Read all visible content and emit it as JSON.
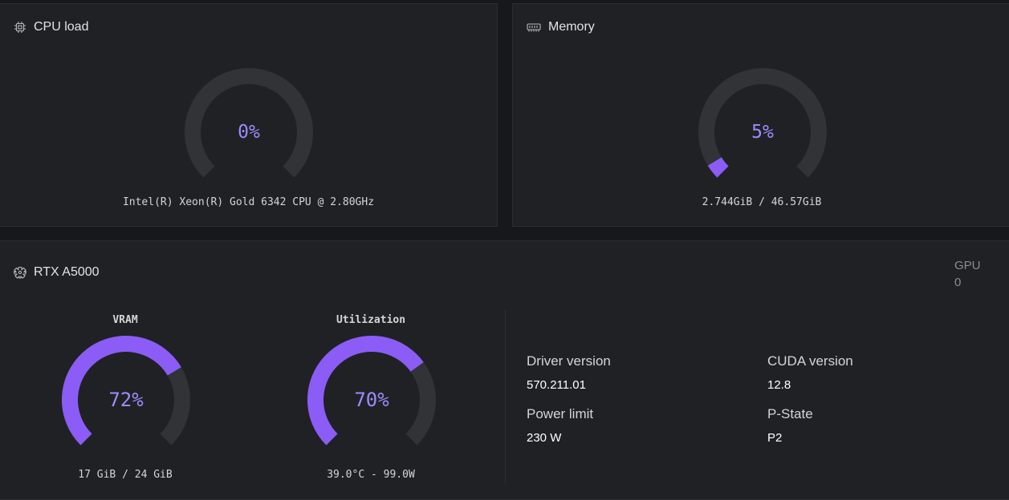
{
  "cpu": {
    "title": "CPU load",
    "icon": "cpu-icon",
    "value_label": "0%",
    "percent": 0,
    "caption": "Intel(R) Xeon(R) Gold 6342 CPU @ 2.80GHz"
  },
  "memory": {
    "title": "Memory",
    "icon": "memory-icon",
    "value_label": "5%",
    "percent": 5,
    "caption": "2.744GiB / 46.57GiB"
  },
  "gpu": {
    "title": "RTX A5000",
    "icon": "gpu-icon",
    "index_label": "GPU",
    "index_value": "0",
    "vram": {
      "title": "VRAM",
      "value_label": "72%",
      "percent": 72,
      "caption": "17 GiB / 24 GiB"
    },
    "utilization": {
      "title": "Utilization",
      "value_label": "70%",
      "percent": 70,
      "caption": "39.0°C - 99.0W"
    },
    "info": {
      "driver_label": "Driver version",
      "driver_value": "570.211.01",
      "cuda_label": "CUDA version",
      "cuda_value": "12.8",
      "power_label": "Power limit",
      "power_value": "230 W",
      "pstate_label": "P-State",
      "pstate_value": "P2"
    }
  },
  "colors": {
    "accent": "#8b5cf6",
    "track": "#323337",
    "value_text": "#9c8bff",
    "card_bg": "#202124",
    "page_bg": "#17181b"
  }
}
